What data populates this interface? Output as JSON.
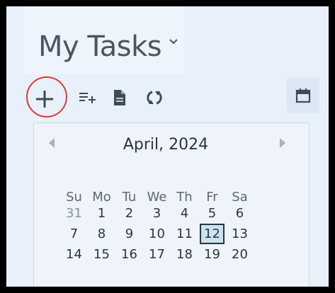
{
  "header": {
    "title": "My Tasks"
  },
  "toolbar": {
    "items": [
      {
        "name": "add-task-button",
        "icon": "plus-icon"
      },
      {
        "name": "add-list-button",
        "icon": "list-add-icon"
      },
      {
        "name": "notes-button",
        "icon": "document-icon"
      },
      {
        "name": "sync-button",
        "icon": "sync-icon"
      },
      {
        "name": "calendar-toggle-button",
        "icon": "calendar-icon"
      }
    ]
  },
  "calendar": {
    "month_label": "April, 2024",
    "weekdays": [
      "Su",
      "Mo",
      "Tu",
      "We",
      "Th",
      "Fr",
      "Sa"
    ],
    "weeks": [
      [
        {
          "d": "31",
          "muted": true
        },
        {
          "d": "1"
        },
        {
          "d": "2"
        },
        {
          "d": "3"
        },
        {
          "d": "4"
        },
        {
          "d": "5"
        },
        {
          "d": "6"
        }
      ],
      [
        {
          "d": "7"
        },
        {
          "d": "8"
        },
        {
          "d": "9"
        },
        {
          "d": "10"
        },
        {
          "d": "11"
        },
        {
          "d": "12",
          "selected": true
        },
        {
          "d": "13"
        }
      ],
      [
        {
          "d": "14"
        },
        {
          "d": "15"
        },
        {
          "d": "16"
        },
        {
          "d": "17"
        },
        {
          "d": "18"
        },
        {
          "d": "19"
        },
        {
          "d": "20"
        }
      ]
    ]
  },
  "colors": {
    "panel_bg": "#e8f1fa",
    "icon": "#3d4a57",
    "highlight": "#d73a3a",
    "selected_day_bg": "#cbe2f0"
  }
}
